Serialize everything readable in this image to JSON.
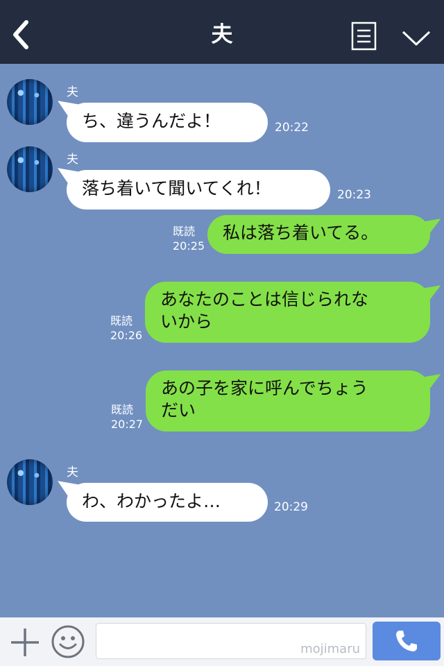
{
  "header": {
    "title": "夫"
  },
  "messages": [
    {
      "sender": "夫",
      "text": "ち、違うんだよ！",
      "time": "20:22"
    },
    {
      "sender": "夫",
      "text": "落ち着いて聞いてくれ！",
      "time": "20:23"
    },
    {
      "read": "既読",
      "text": "私は落ち着いてる。",
      "time": "20:25"
    },
    {
      "read": "既読",
      "line1": "あなたのことは信じられな",
      "line2": "いから",
      "time": "20:26"
    },
    {
      "read": "既読",
      "line1": "あの子を家に呼んでちょう",
      "line2": "だい",
      "time": "20:27"
    },
    {
      "sender": "夫",
      "text": "わ、わかったよ…",
      "time": "20:29"
    }
  ],
  "footer": {
    "watermark": "mojimaru"
  },
  "icons": [
    "back-icon",
    "notes-icon",
    "chevron-down-icon",
    "plus-icon",
    "smile-icon",
    "phone-icon"
  ],
  "colors": {
    "header": "#232d3f",
    "background": "#7190c0",
    "outgoing": "#84e048",
    "call": "#5a8be0"
  }
}
